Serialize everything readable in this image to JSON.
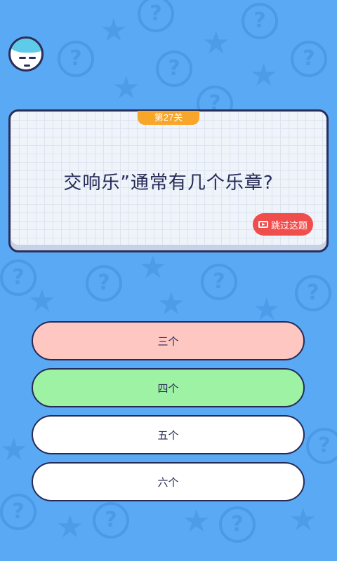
{
  "level": {
    "label": "第27关"
  },
  "question": {
    "text": "交响乐”通常有几个乐章?"
  },
  "skip_button": {
    "label": "跳过这题",
    "icon": "video-icon"
  },
  "options": [
    {
      "label": "三个",
      "state": "wrong"
    },
    {
      "label": "四个",
      "state": "correct"
    },
    {
      "label": "五个",
      "state": "default"
    },
    {
      "label": "六个",
      "state": "default"
    }
  ],
  "colors": {
    "background": "#5aa9f5",
    "level_tab": "#f7a62a",
    "skip_button": "#f04d4d",
    "wrong_option": "#ffc7c2",
    "correct_option": "#9df3a3",
    "default_option": "#ffffff",
    "text": "#262a56"
  }
}
